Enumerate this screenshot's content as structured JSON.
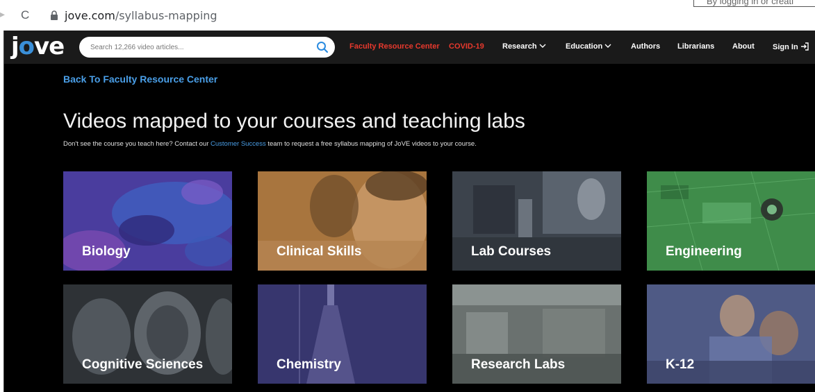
{
  "browser": {
    "url_host": "jove.com",
    "url_path": "/syllabus-mapping",
    "corner_text": "By logging in or creati"
  },
  "header": {
    "logo": [
      "j",
      "o",
      "ve"
    ],
    "search_placeholder": "Search 12,266 video articles...",
    "nav": {
      "faculty": "Faculty Resource Center",
      "covid": "COVID-19",
      "research": "Research",
      "education": "Education",
      "authors": "Authors",
      "librarians": "Librarians",
      "about": "About",
      "signin": "Sign In"
    }
  },
  "content": {
    "back_link": "Back To Faculty Resource Center",
    "headline": "Videos mapped to your courses and teaching labs",
    "subtext_pre": "Don't see the course you teach here? Contact our ",
    "subtext_link": "Customer Success",
    "subtext_post": " team to request a free syllabus mapping of JoVE videos to your course.",
    "tiles": [
      {
        "label": "Biology",
        "color": "#5a4aa8"
      },
      {
        "label": "Clinical Skills",
        "color": "#b07a3e"
      },
      {
        "label": "Lab Courses",
        "color": "#3a4048"
      },
      {
        "label": "Engineering",
        "color": "#3f8a4a"
      },
      {
        "label": "Cognitive Sciences",
        "color": "#2f3338"
      },
      {
        "label": "Chemistry",
        "color": "#3a3870"
      },
      {
        "label": "Research Labs",
        "color": "#5f6664"
      },
      {
        "label": "K-12",
        "color": "#4d5780"
      }
    ]
  }
}
